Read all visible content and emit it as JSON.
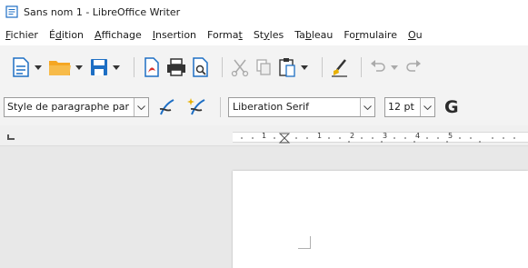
{
  "window": {
    "title": "Sans nom 1 - LibreOffice Writer"
  },
  "menu": [
    {
      "pre": "",
      "acc": "F",
      "post": "ichier"
    },
    {
      "pre": "É",
      "acc": "d",
      "post": "ition"
    },
    {
      "pre": "",
      "acc": "A",
      "post": "ffichage"
    },
    {
      "pre": "",
      "acc": "I",
      "post": "nsertion"
    },
    {
      "pre": "Forma",
      "acc": "t",
      "post": ""
    },
    {
      "pre": "St",
      "acc": "y",
      "post": "les"
    },
    {
      "pre": "Ta",
      "acc": "b",
      "post": "leau"
    },
    {
      "pre": "Fo",
      "acc": "r",
      "post": "mulaire"
    },
    {
      "pre": "",
      "acc": "O",
      "post": "u"
    }
  ],
  "formatting": {
    "paragraph_style": "Style de paragraphe par",
    "font_name": "Liberation Serif",
    "font_size": "12 pt",
    "bold_glyph": "G"
  },
  "ruler": {
    "marks": [
      "1",
      "1",
      "2",
      "3",
      "4",
      "5"
    ]
  },
  "colors": {
    "accent_blue": "#1e6fc4",
    "folder_orange": "#f5a623",
    "pdf_red": "#d9302b",
    "brush_yellow": "#e8b100"
  }
}
